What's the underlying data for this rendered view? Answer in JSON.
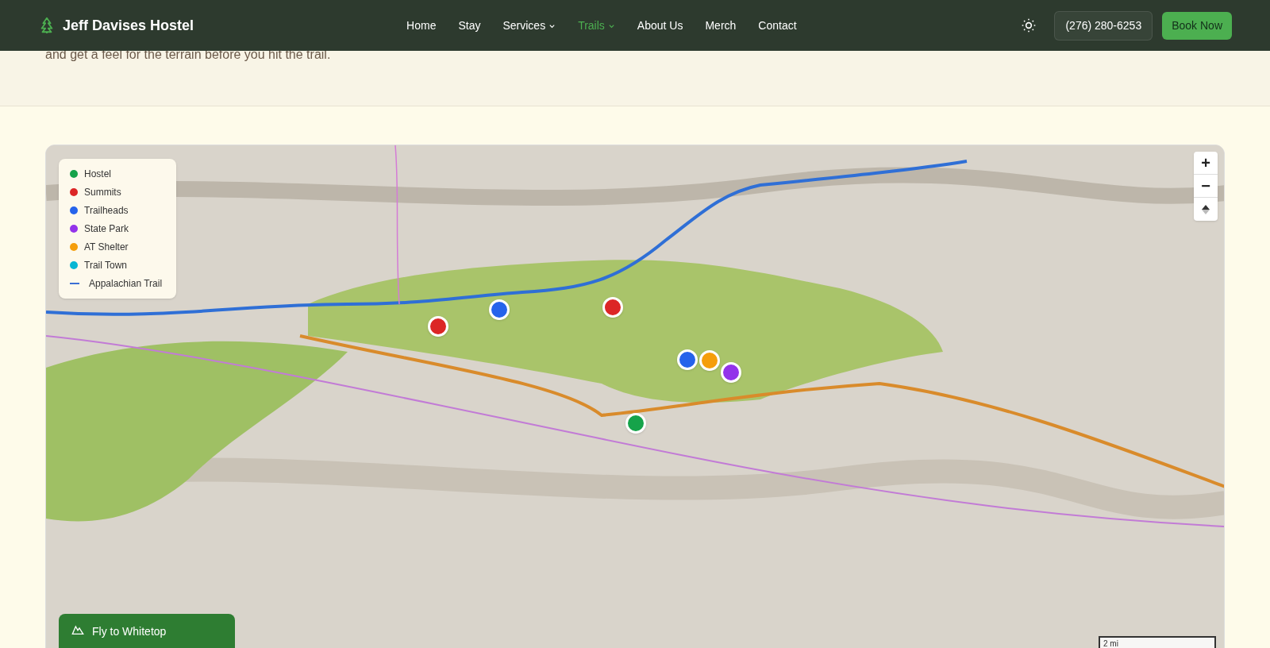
{
  "header": {
    "brand": "Jeff Davises Hostel",
    "nav": [
      {
        "label": "Home",
        "selected": false,
        "dropdown": false
      },
      {
        "label": "Stay",
        "selected": false,
        "dropdown": false
      },
      {
        "label": "Services",
        "selected": false,
        "dropdown": true
      },
      {
        "label": "Trails",
        "selected": true,
        "dropdown": true
      },
      {
        "label": "About Us",
        "selected": false,
        "dropdown": false
      },
      {
        "label": "Merch",
        "selected": false,
        "dropdown": false
      },
      {
        "label": "Contact",
        "selected": false,
        "dropdown": false
      }
    ],
    "phone": "(276) 280-6253",
    "cta": "Book Now"
  },
  "intro": {
    "text": "and get a feel for the terrain before you hit the trail."
  },
  "map": {
    "legend": [
      {
        "label": "Hostel",
        "kind": "dot",
        "color": "#16a34a"
      },
      {
        "label": "Summits",
        "kind": "dot",
        "color": "#dc2626"
      },
      {
        "label": "Trailheads",
        "kind": "dot",
        "color": "#2563eb"
      },
      {
        "label": "State Park",
        "kind": "dot",
        "color": "#9333ea"
      },
      {
        "label": "AT Shelter",
        "kind": "dot",
        "color": "#f59e0b"
      },
      {
        "label": "Trail Town",
        "kind": "dot",
        "color": "#06b6d4"
      },
      {
        "label": "Appalachian Trail",
        "kind": "line",
        "color": "#3b6fd4"
      }
    ],
    "markers": [
      {
        "color": "#dc2626"
      },
      {
        "color": "#2563eb"
      },
      {
        "color": "#dc2626"
      },
      {
        "color": "#2563eb"
      },
      {
        "color": "#f59e0b"
      },
      {
        "color": "#9333ea"
      },
      {
        "color": "#16a34a"
      }
    ],
    "controls": [
      "+",
      "−"
    ],
    "fly_button": "Fly to Whitetop",
    "scale": "2 mi"
  }
}
